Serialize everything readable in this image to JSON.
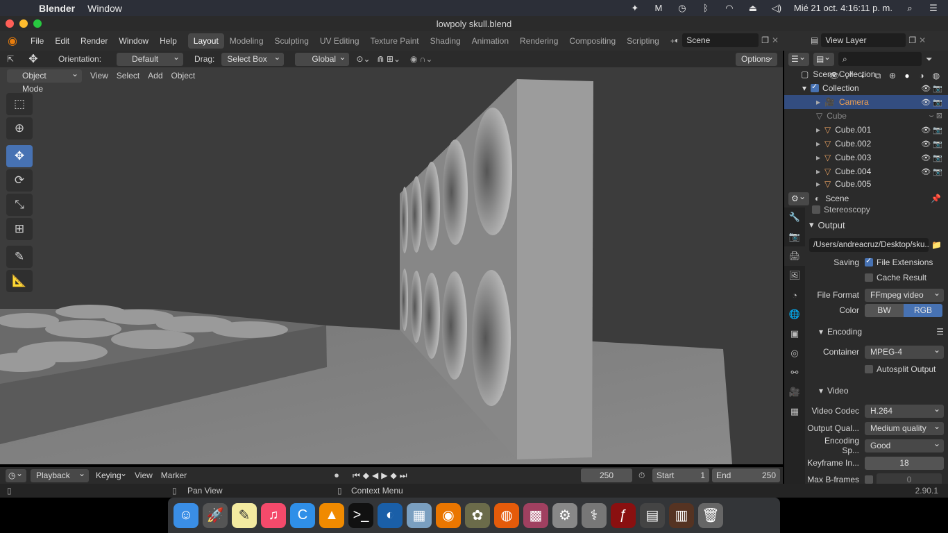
{
  "mac_menu": {
    "app": "Blender",
    "window": "Window",
    "datetime": "Mié 21 oct.  4:16:11 p. m."
  },
  "window_title": "lowpoly skull.blend",
  "topbar": {
    "menus": [
      "File",
      "Edit",
      "Render",
      "Window",
      "Help"
    ],
    "workspaces": [
      "Layout",
      "Modeling",
      "Sculpting",
      "UV Editing",
      "Texture Paint",
      "Shading",
      "Animation",
      "Rendering",
      "Compositing",
      "Scripting"
    ],
    "active_workspace": "Layout",
    "scene": "Scene",
    "view_layer": "View Layer"
  },
  "tool_header": {
    "orientation_label": "Orientation:",
    "orientation_value": "Default",
    "drag_label": "Drag:",
    "drag_value": "Select Box",
    "transform_space": "Global",
    "options": "Options"
  },
  "viewport_header": {
    "mode": "Object Mode",
    "menus": [
      "View",
      "Select",
      "Add",
      "Object"
    ]
  },
  "outliner": {
    "root": "Scene Collection",
    "collection": "Collection",
    "items": [
      {
        "name": "Camera",
        "selected": true
      },
      {
        "name": "Cube",
        "hidden": true
      },
      {
        "name": "Cube.001"
      },
      {
        "name": "Cube.002"
      },
      {
        "name": "Cube.003"
      },
      {
        "name": "Cube.004"
      },
      {
        "name": "Cube.005"
      }
    ]
  },
  "properties": {
    "context": "Scene",
    "stereoscopy": "Stereoscopy",
    "output_panel": "Output",
    "output_path": "/Users/andreacruz/Desktop/sku...",
    "saving_label": "Saving",
    "file_extensions": "File Extensions",
    "cache_result": "Cache Result",
    "file_format_label": "File Format",
    "file_format": "FFmpeg video",
    "color_label": "Color",
    "color_bw": "BW",
    "color_rgb": "RGB",
    "encoding_panel": "Encoding",
    "container_label": "Container",
    "container": "MPEG-4",
    "autosplit": "Autosplit Output",
    "video_panel": "Video",
    "video_codec_label": "Video Codec",
    "video_codec": "H.264",
    "output_quality_label": "Output Qual...",
    "output_quality": "Medium quality",
    "encoding_speed_label": "Encoding Sp...",
    "encoding_speed": "Good",
    "keyframe_label": "Keyframe In...",
    "keyframe": "18",
    "max_bframes_label": "Max B-frames",
    "max_bframes": "0"
  },
  "timeline": {
    "menus": [
      "Playback",
      "Keying",
      "View",
      "Marker"
    ],
    "current_frame": "250",
    "start_label": "Start",
    "start": "1",
    "end_label": "End",
    "end": "250"
  },
  "statusbar": {
    "pan": "Pan View",
    "context": "Context Menu",
    "version": "2.90.1"
  },
  "colors": {
    "accent": "#4772b3",
    "selected_row": "#334d80",
    "camera_text": "#f0a050"
  }
}
